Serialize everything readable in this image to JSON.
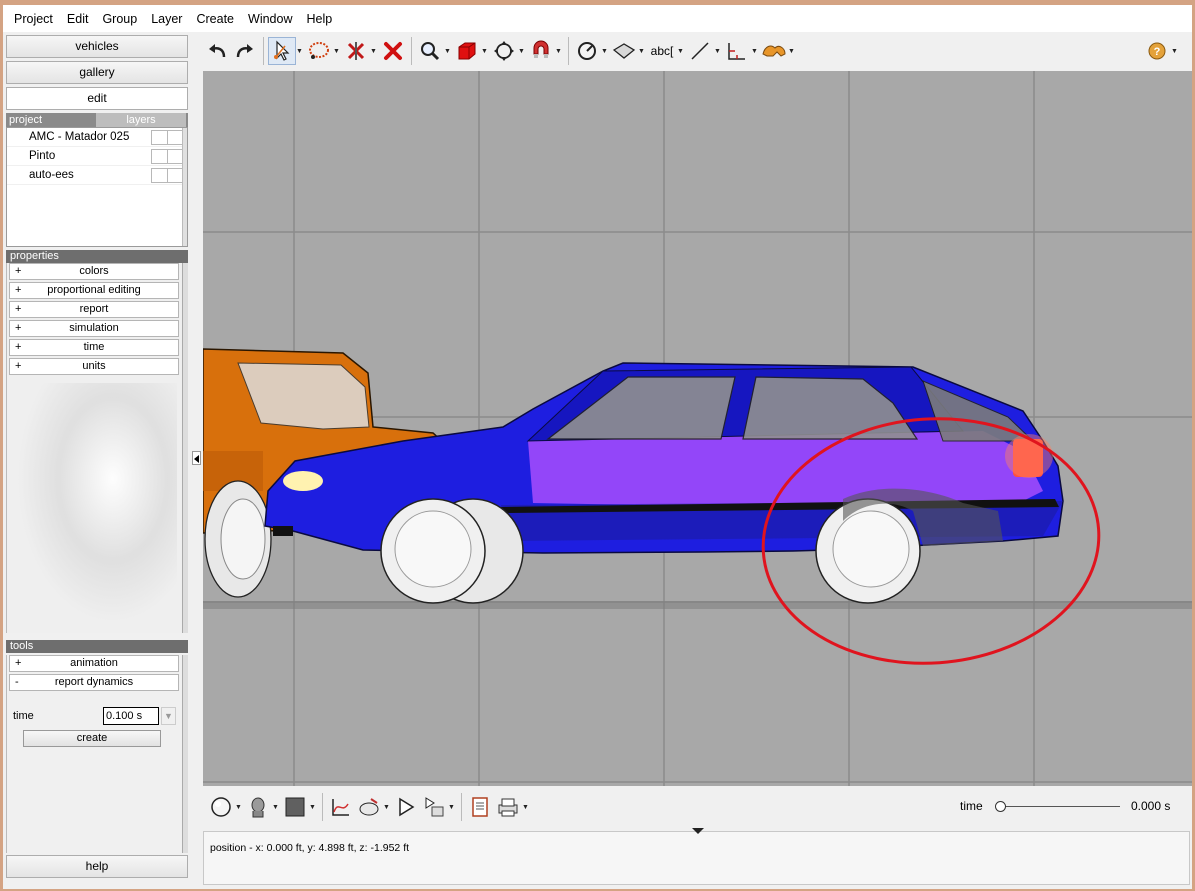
{
  "menu": [
    "Project",
    "Edit",
    "Group",
    "Layer",
    "Create",
    "Window",
    "Help"
  ],
  "nav": {
    "vehicles": "vehicles",
    "gallery": "gallery",
    "edit": "edit",
    "help": "help"
  },
  "project_panel": {
    "tab_project": "project",
    "tab_layers": "layers",
    "items": [
      "AMC - Matador 025",
      "Pinto",
      "auto-ees"
    ]
  },
  "properties": {
    "header": "properties",
    "items": [
      {
        "sign": "+",
        "label": "colors"
      },
      {
        "sign": "+",
        "label": "proportional editing"
      },
      {
        "sign": "+",
        "label": "report"
      },
      {
        "sign": "+",
        "label": "simulation"
      },
      {
        "sign": "+",
        "label": "time"
      },
      {
        "sign": "+",
        "label": "units"
      }
    ]
  },
  "tools": {
    "header": "tools",
    "items": [
      {
        "sign": "+",
        "label": "animation"
      },
      {
        "sign": "-",
        "label": "report dynamics"
      }
    ],
    "time_label": "time",
    "time_value": "0.100 s",
    "create_label": "create"
  },
  "toolbar": {
    "text_tool": "abc"
  },
  "timeline": {
    "label": "time",
    "value": "0.000 s",
    "position": 0
  },
  "status": {
    "text": "position - x: 0.000 ft, y: 4.898 ft, z: -1.952 ft"
  },
  "colors": {
    "blue_car": "#1e1ee0",
    "orange_car": "#d8700c",
    "annotation": "#e0141e"
  }
}
